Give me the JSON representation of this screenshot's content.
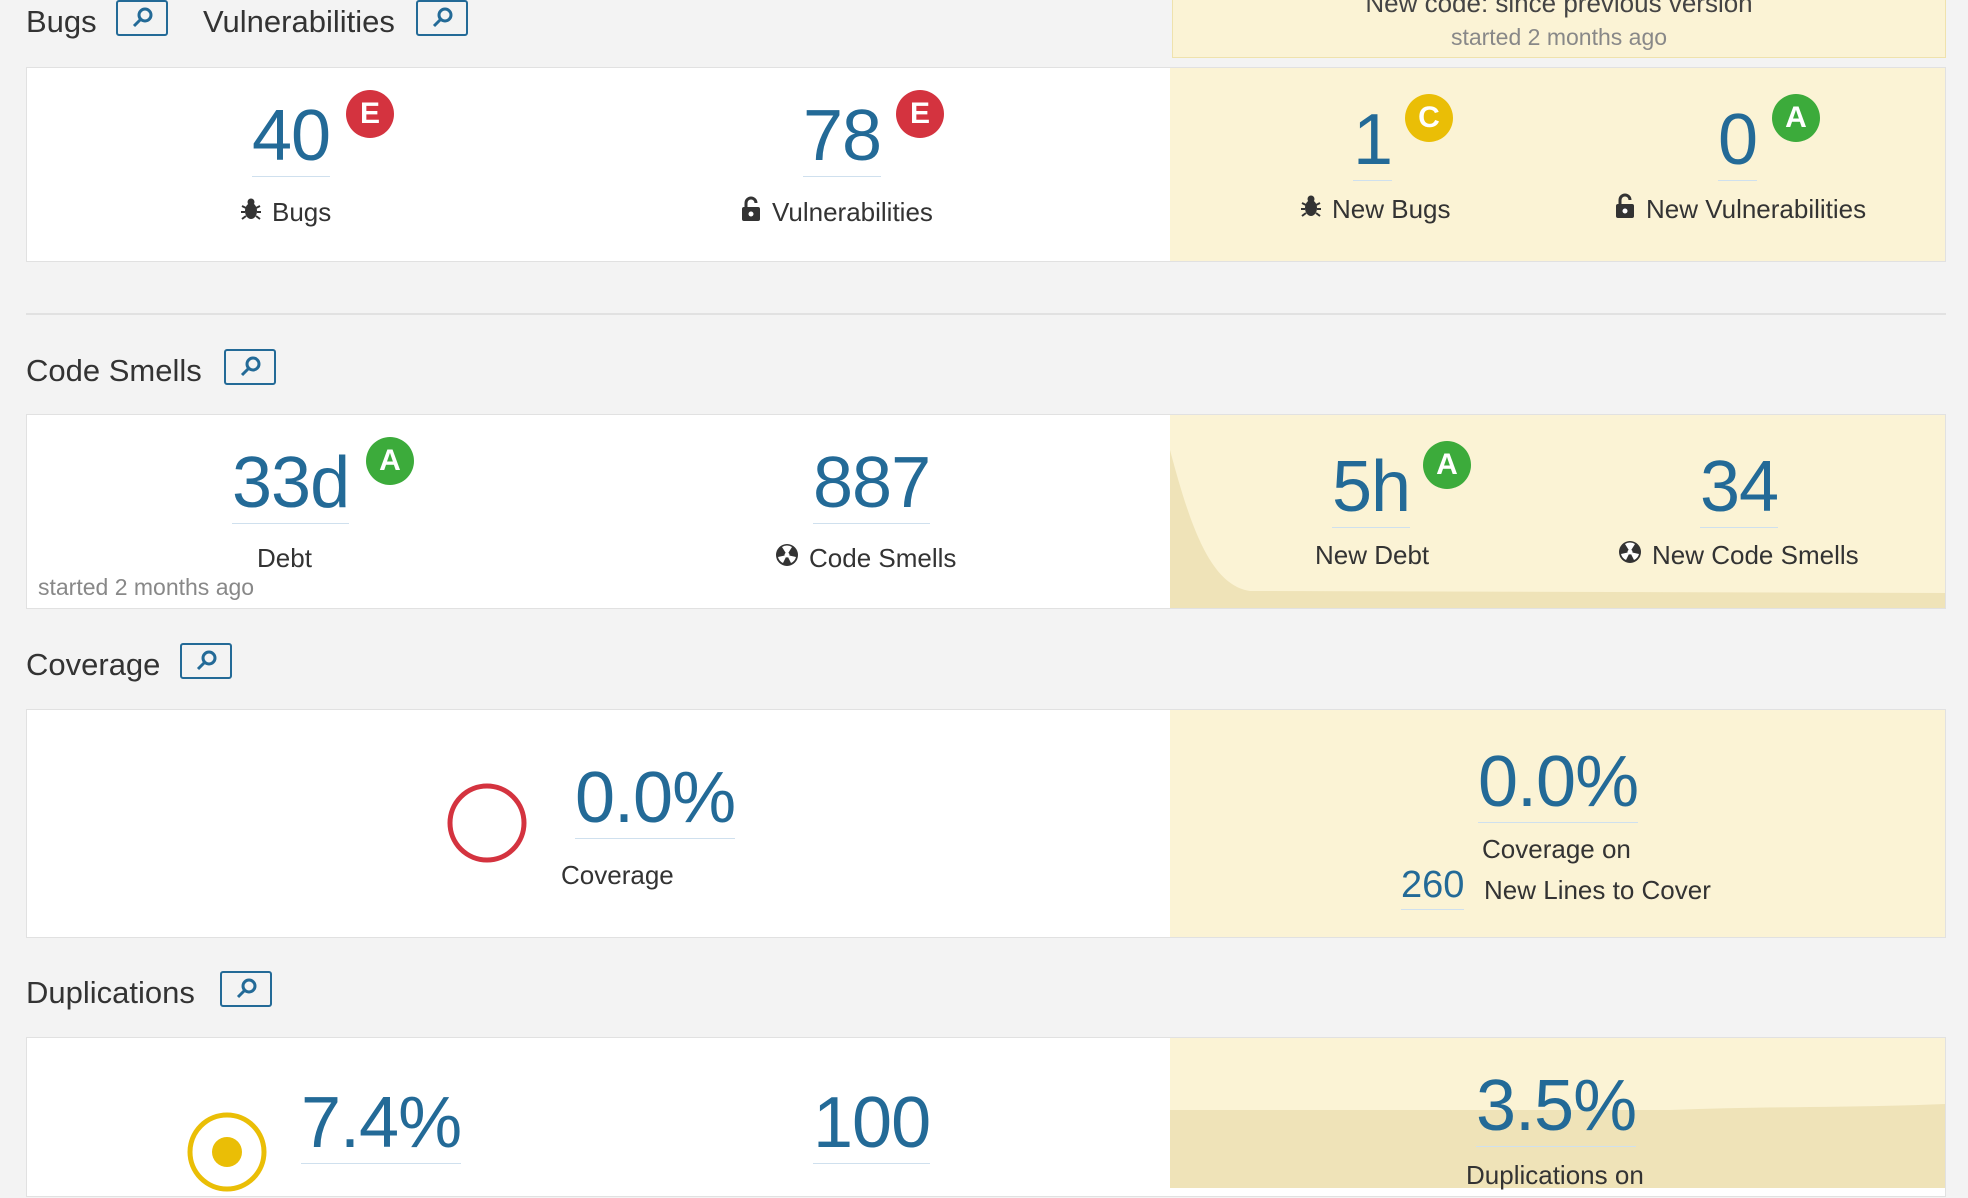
{
  "sections": {
    "bugs_title": "Bugs",
    "vulnerabilities_title": "Vulnerabilities",
    "code_smells_title": "Code Smells",
    "coverage_title": "Coverage",
    "duplications_title": "Duplications"
  },
  "leak_period": {
    "title": "New code: since previous version",
    "subtitle": "started 2 months ago"
  },
  "bugs_panel": {
    "bugs_value": "40",
    "bugs_rating": "E",
    "bugs_label": "Bugs",
    "vuln_value": "78",
    "vuln_rating": "E",
    "vuln_label": "Vulnerabilities",
    "new_bugs_value": "1",
    "new_bugs_rating": "C",
    "new_bugs_label": "New Bugs",
    "new_vuln_value": "0",
    "new_vuln_rating": "A",
    "new_vuln_label": "New Vulnerabilities"
  },
  "smells_panel": {
    "debt_value": "33d",
    "debt_rating": "A",
    "debt_label": "Debt",
    "started": "started 2 months ago",
    "smells_value": "887",
    "smells_label": "Code Smells",
    "new_debt_value": "5h",
    "new_debt_rating": "A",
    "new_debt_label": "New Debt",
    "new_smells_value": "34",
    "new_smells_label": "New Code Smells"
  },
  "coverage_panel": {
    "coverage_value": "0.0%",
    "coverage_label": "Coverage",
    "new_coverage_value": "0.0%",
    "new_coverage_label": "Coverage on",
    "new_lines_value": "260",
    "new_lines_label": "New Lines to Cover"
  },
  "duplications_panel": {
    "dup_value": "7.4%",
    "dup_blocks_value": "100",
    "new_dup_value": "3.5%",
    "new_dup_label": "Duplications on"
  },
  "colors": {
    "link": "#236a97",
    "rating_E": "#d4333f",
    "rating_C": "#eabe06",
    "rating_A": "#3cab3b",
    "leak_bg": "#fbf3d5"
  }
}
